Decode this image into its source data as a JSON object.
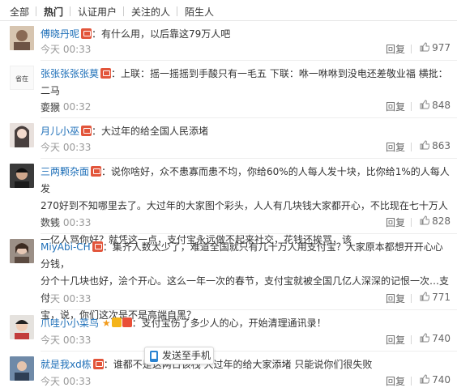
{
  "tabs": [
    "全部",
    "热门",
    "认证用户",
    "关注的人",
    "陌生人"
  ],
  "reply_label": "回复",
  "send_phone_label": "发送至手机",
  "comments": [
    {
      "user": "傅晓丹呢",
      "text": "：有什么用，以后靠这79万人吧",
      "time": "今天 00:33",
      "likes": "977"
    },
    {
      "user": "张张张张张莫",
      "line1": "：上联：摇一摇摇到手酸只有一毛五 下联：咻一咻咻到没电还差敬业福 横批：二马",
      "line2": "耍猴",
      "time": "今天 00:32",
      "likes": "848"
    },
    {
      "user": "月儿小巫",
      "text": "：大过年的给全国人民添堵",
      "time": "今天 00:33",
      "likes": "863"
    },
    {
      "user": "三两颗杂面",
      "line1": "：说你啥好，众不患寡而患不均，你给60%的人每人发十块，比你给1%的人每人发",
      "line2": "270好到不知哪里去了。大过年的大家图个彩头，人人有几块钱大家都开心，不比现在七十万人数钱",
      "line3": "一亿人骂你好？就凭这一点，支付宝永远做不起来社交，花钱还挨骂，该",
      "time": "今天 00:33",
      "likes": "828"
    },
    {
      "user": "MiyAbi-CH",
      "line1": "：集齐人数太少了，难道全国就只有几十万人用支付宝？大家原本都想开开心心分钱，",
      "line2": "分个十几块也好，浍个开心。这么一年一次的春节，支付宝就被全国几亿人深深的记恨一次…支付",
      "line3": "宝，说，你们这次是不是高端自黑？",
      "time": "今天 00:33",
      "likes": "771"
    },
    {
      "user": "爪哇小小菜鸟",
      "text": "：支付宝伤了多少人的心，开始清理通讯录！",
      "time": "今天 00:33",
      "likes": "740"
    },
    {
      "user": "就是我xd栋",
      "text": "：谁都不是这两日该栈 大过年的给大家添堵 只能说你们很失败",
      "time": "今天 00:33",
      "likes": "740"
    }
  ],
  "colors": {
    "link": "#1e6fb8",
    "badge": "#e2553b",
    "time": "#999999"
  }
}
